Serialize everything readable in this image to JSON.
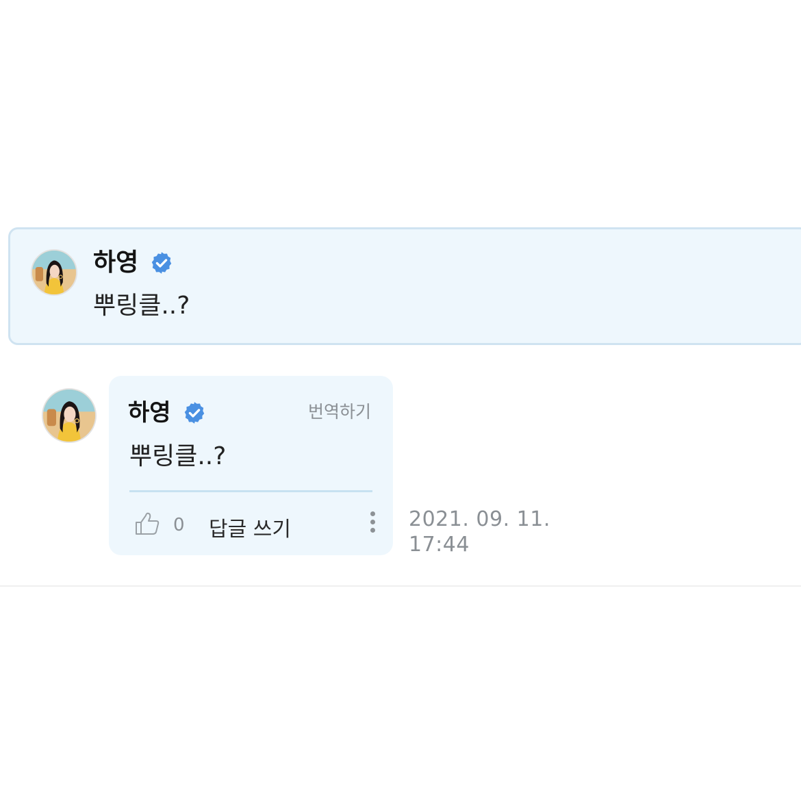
{
  "highlighted_comment": {
    "author": "하영",
    "verified": true,
    "text": "뿌링클..?"
  },
  "reply": {
    "author": "하영",
    "verified": true,
    "translate_label": "번역하기",
    "text": "뿌링클..?",
    "like_count": "0",
    "reply_label": "답글 쓰기",
    "timestamp_date": "2021. 09. 11.",
    "timestamp_time": "17:44"
  },
  "icons": {
    "verified": "verified-badge-icon",
    "like": "thumbs-up-icon",
    "more": "more-vertical-icon"
  },
  "colors": {
    "card_background": "#eef7fd",
    "card_border": "#cfe3f1",
    "verified_badge": "#4a90e2",
    "muted_text": "#8a8f94"
  }
}
